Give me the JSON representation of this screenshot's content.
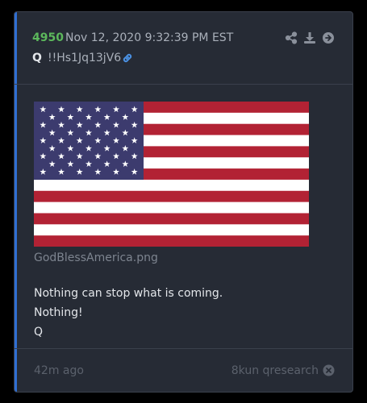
{
  "post": {
    "number": "4950",
    "date": "Nov 12, 2020 9:32:39 PM EST",
    "author": "Q",
    "tripcode": "!!Hs1Jq13jV6",
    "image_filename": "GodBlessAmerica.png",
    "lines": [
      "Nothing can stop what is coming.",
      "Nothing!",
      "Q"
    ]
  },
  "footer": {
    "age": "42m ago",
    "source": "8kun qresearch"
  },
  "icons": {
    "share": "share-icon",
    "download": "download-icon",
    "forward": "arrow-right-circle-icon",
    "link": "link-icon",
    "close": "close-circle-icon"
  },
  "colors": {
    "accent": "#2f6fd4",
    "post_number": "#5cb85c",
    "link": "#4a90e2",
    "card_bg": "#262b35"
  }
}
